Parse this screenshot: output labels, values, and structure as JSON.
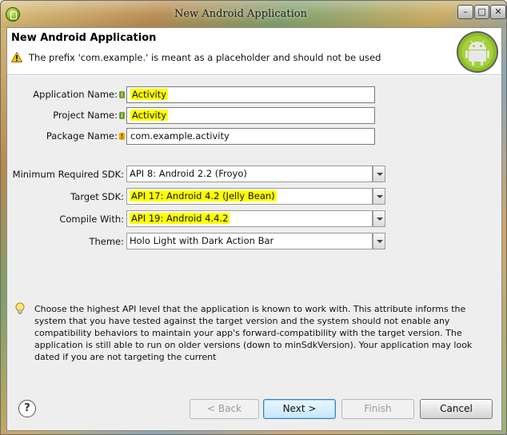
{
  "window": {
    "title": "New Android Application",
    "minimize_glyph": "–",
    "maximize_glyph": "□",
    "close_glyph": "✕"
  },
  "header": {
    "title": "New Android Application",
    "message": "The prefix 'com.example.' is meant as a placeholder and should not be used"
  },
  "form": {
    "application_name": {
      "label": "Application Name:",
      "value": "Activity"
    },
    "project_name": {
      "label": "Project Name:",
      "value": "Activity"
    },
    "package_name": {
      "label": "Package Name:",
      "value": "com.example.activity"
    },
    "min_sdk": {
      "label": "Minimum Required SDK:",
      "value": "API 8: Android 2.2 (Froyo)"
    },
    "target_sdk": {
      "label": "Target SDK:",
      "value": "API 17: Android 4.2 (Jelly Bean)"
    },
    "compile_with": {
      "label": "Compile With:",
      "value": "API 19: Android 4.4.2"
    },
    "theme": {
      "label": "Theme:",
      "value": "Holo Light with Dark Action Bar"
    }
  },
  "description": "Choose the highest API level that the application is known to work with. This attribute informs the system that you have tested against the target version and the system should not enable any compatibility behaviors to maintain your app's forward-compatibility with the target version. The application is still able to run on older versions (down to minSdkVersion). Your application may look dated if you are not targeting the current",
  "buttons": {
    "help": "?",
    "back": "< Back",
    "next": "Next >",
    "finish": "Finish",
    "cancel": "Cancel"
  },
  "colors": {
    "highlight": "#ffff00",
    "android_green": "#a4c639",
    "default_button_border": "#3c7fb1"
  },
  "icons": {
    "warning": "warning-icon",
    "info": "info-icon",
    "lightbulb": "lightbulb-icon",
    "android": "android-logo-icon"
  }
}
